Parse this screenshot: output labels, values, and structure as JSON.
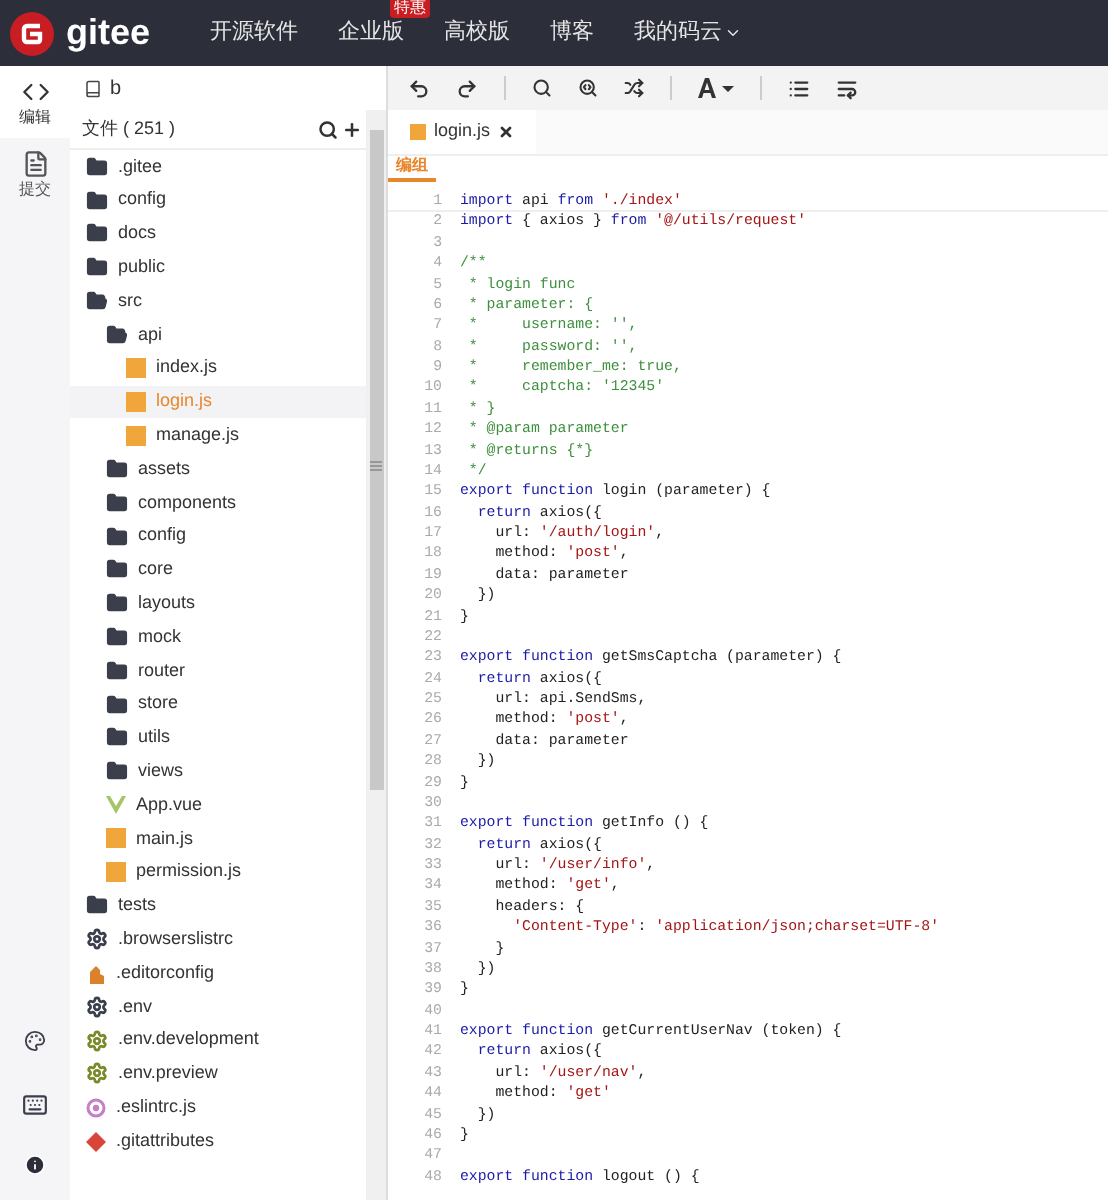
{
  "nav": {
    "logo": "gitee",
    "items": [
      {
        "label": "开源软件"
      },
      {
        "label": "企业版",
        "badge": "特惠"
      },
      {
        "label": "高校版"
      },
      {
        "label": "博客"
      },
      {
        "label": "我的码云",
        "dropdown": true
      }
    ]
  },
  "rail": {
    "items": [
      {
        "label": "编辑",
        "kind": "code",
        "selected": true
      },
      {
        "label": "提交",
        "kind": "commit",
        "selected": false
      }
    ]
  },
  "repo": {
    "name": "b"
  },
  "files": {
    "label": "文件 ( 251 )"
  },
  "tree": [
    {
      "name": ".gitee",
      "kind": "folder",
      "expanded": false,
      "selected": false
    },
    {
      "name": "config",
      "kind": "folder",
      "expanded": false,
      "selected": false
    },
    {
      "name": "docs",
      "kind": "folder",
      "expanded": false,
      "selected": false
    },
    {
      "name": "public",
      "kind": "folder",
      "expanded": false,
      "selected": false
    },
    {
      "name": "src",
      "kind": "folder",
      "expanded": true,
      "selected": false,
      "children": [
        {
          "name": "api",
          "kind": "folder",
          "expanded": true,
          "selected": false,
          "children": [
            {
              "name": "index.js",
              "kind": "js",
              "selected": false
            },
            {
              "name": "login.js",
              "kind": "js",
              "selected": true
            },
            {
              "name": "manage.js",
              "kind": "js",
              "selected": false
            }
          ]
        },
        {
          "name": "assets",
          "kind": "folder",
          "expanded": false,
          "selected": false
        },
        {
          "name": "components",
          "kind": "folder",
          "expanded": false,
          "selected": false
        },
        {
          "name": "config",
          "kind": "folder",
          "expanded": false,
          "selected": false
        },
        {
          "name": "core",
          "kind": "folder",
          "expanded": false,
          "selected": false
        },
        {
          "name": "layouts",
          "kind": "folder",
          "expanded": false,
          "selected": false
        },
        {
          "name": "mock",
          "kind": "folder",
          "expanded": false,
          "selected": false
        },
        {
          "name": "router",
          "kind": "folder",
          "expanded": false,
          "selected": false
        },
        {
          "name": "store",
          "kind": "folder",
          "expanded": false,
          "selected": false
        },
        {
          "name": "utils",
          "kind": "folder",
          "expanded": false,
          "selected": false
        },
        {
          "name": "views",
          "kind": "folder",
          "expanded": false,
          "selected": false
        },
        {
          "name": "App.vue",
          "kind": "vue",
          "selected": false
        },
        {
          "name": "main.js",
          "kind": "js",
          "selected": false
        },
        {
          "name": "permission.js",
          "kind": "js",
          "selected": false
        }
      ]
    },
    {
      "name": "tests",
      "kind": "folder",
      "expanded": false,
      "selected": false
    },
    {
      "name": ".browserslistrc",
      "kind": "gear",
      "color": "#3a3f4b",
      "selected": false
    },
    {
      "name": ".editorconfig",
      "kind": "editorconfig",
      "selected": false
    },
    {
      "name": ".env",
      "kind": "gear",
      "color": "#3a3f4b",
      "selected": false
    },
    {
      "name": ".env.development",
      "kind": "gear",
      "color": "#7a8a2a",
      "selected": false
    },
    {
      "name": ".env.preview",
      "kind": "gear",
      "color": "#7a8a2a",
      "selected": false
    },
    {
      "name": ".eslintrc.js",
      "kind": "eslint",
      "selected": false
    },
    {
      "name": ".gitattributes",
      "kind": "git",
      "selected": false
    }
  ],
  "tabs": [
    {
      "label": "login.js",
      "selected": true,
      "closable": true
    }
  ],
  "mode": {
    "label": "编组"
  },
  "code": [
    {
      "n": "1",
      "segs": [
        {
          "kind": "kw",
          "text": "import"
        },
        {
          "kind": "plain",
          "text": " api "
        },
        {
          "kind": "kw",
          "text": "from"
        },
        {
          "kind": "str",
          "text": " './index'"
        }
      ]
    },
    {
      "n": "2",
      "segs": [
        {
          "kind": "kw",
          "text": "import"
        },
        {
          "kind": "plain",
          "text": " { axios } "
        },
        {
          "kind": "kw",
          "text": "from"
        },
        {
          "kind": "str",
          "text": " '@/utils/request'"
        }
      ]
    },
    {
      "n": "3"
    },
    {
      "n": "4",
      "segs": [
        {
          "kind": "comment",
          "text": "/**"
        }
      ]
    },
    {
      "n": "5",
      "segs": [
        {
          "kind": "comment",
          "text": " * login func"
        }
      ]
    },
    {
      "n": "6",
      "segs": [
        {
          "kind": "comment",
          "text": " * parameter: {"
        }
      ]
    },
    {
      "n": "7",
      "segs": [
        {
          "kind": "comment",
          "text": " *     username: '',"
        }
      ]
    },
    {
      "n": "8",
      "segs": [
        {
          "kind": "comment",
          "text": " *     password: '',"
        }
      ]
    },
    {
      "n": "9",
      "segs": [
        {
          "kind": "comment",
          "text": " *     remember_me: true,"
        }
      ]
    },
    {
      "n": "10",
      "segs": [
        {
          "kind": "comment",
          "text": " *     captcha: '12345'"
        }
      ]
    },
    {
      "n": "11",
      "segs": [
        {
          "kind": "comment",
          "text": " * }"
        }
      ]
    },
    {
      "n": "12",
      "segs": [
        {
          "kind": "comment",
          "text": " * @param parameter"
        }
      ]
    },
    {
      "n": "13",
      "segs": [
        {
          "kind": "comment",
          "text": " * @returns {*}"
        }
      ]
    },
    {
      "n": "14",
      "segs": [
        {
          "kind": "comment",
          "text": " */"
        }
      ]
    },
    {
      "n": "15",
      "segs": [
        {
          "kind": "kw",
          "text": "export function"
        },
        {
          "kind": "plain",
          "text": " login (parameter) {"
        }
      ]
    },
    {
      "n": "16",
      "segs": [
        {
          "kind": "kw",
          "text": "  return"
        },
        {
          "kind": "plain",
          "text": " axios({"
        }
      ]
    },
    {
      "n": "17",
      "segs": [
        {
          "kind": "plain",
          "text": "    url: "
        },
        {
          "kind": "str",
          "text": "'/auth/login'"
        },
        {
          "kind": "plain",
          "text": ","
        }
      ]
    },
    {
      "n": "18",
      "segs": [
        {
          "kind": "plain",
          "text": "    method: "
        },
        {
          "kind": "str",
          "text": "'post'"
        },
        {
          "kind": "plain",
          "text": ","
        }
      ]
    },
    {
      "n": "19",
      "segs": [
        {
          "kind": "plain",
          "text": "    data: parameter"
        }
      ]
    },
    {
      "n": "20",
      "segs": [
        {
          "kind": "plain",
          "text": "  })"
        }
      ]
    },
    {
      "n": "21",
      "segs": [
        {
          "kind": "plain",
          "text": "}"
        }
      ]
    },
    {
      "n": "22"
    },
    {
      "n": "23",
      "segs": [
        {
          "kind": "kw",
          "text": "export function"
        },
        {
          "kind": "plain",
          "text": " getSmsCaptcha (parameter) {"
        }
      ]
    },
    {
      "n": "24",
      "segs": [
        {
          "kind": "kw",
          "text": "  return"
        },
        {
          "kind": "plain",
          "text": " axios({"
        }
      ]
    },
    {
      "n": "25",
      "segs": [
        {
          "kind": "plain",
          "text": "    url: api.SendSms,"
        }
      ]
    },
    {
      "n": "26",
      "segs": [
        {
          "kind": "plain",
          "text": "    method: "
        },
        {
          "kind": "str",
          "text": "'post'"
        },
        {
          "kind": "plain",
          "text": ","
        }
      ]
    },
    {
      "n": "27",
      "segs": [
        {
          "kind": "plain",
          "text": "    data: parameter"
        }
      ]
    },
    {
      "n": "28",
      "segs": [
        {
          "kind": "plain",
          "text": "  })"
        }
      ]
    },
    {
      "n": "29",
      "segs": [
        {
          "kind": "plain",
          "text": "}"
        }
      ]
    },
    {
      "n": "30"
    },
    {
      "n": "31",
      "segs": [
        {
          "kind": "kw",
          "text": "export function"
        },
        {
          "kind": "plain",
          "text": " getInfo () {"
        }
      ]
    },
    {
      "n": "32",
      "segs": [
        {
          "kind": "kw",
          "text": "  return"
        },
        {
          "kind": "plain",
          "text": " axios({"
        }
      ]
    },
    {
      "n": "33",
      "segs": [
        {
          "kind": "plain",
          "text": "    url: "
        },
        {
          "kind": "str",
          "text": "'/user/info'"
        },
        {
          "kind": "plain",
          "text": ","
        }
      ]
    },
    {
      "n": "34",
      "segs": [
        {
          "kind": "plain",
          "text": "    method: "
        },
        {
          "kind": "str",
          "text": "'get'"
        },
        {
          "kind": "plain",
          "text": ","
        }
      ]
    },
    {
      "n": "35",
      "segs": [
        {
          "kind": "plain",
          "text": "    headers: {"
        }
      ]
    },
    {
      "n": "36",
      "segs": [
        {
          "kind": "str",
          "text": "      'Content-Type'"
        },
        {
          "kind": "plain",
          "text": ": "
        },
        {
          "kind": "str",
          "text": "'application/json;charset=UTF-8'"
        }
      ]
    },
    {
      "n": "37",
      "segs": [
        {
          "kind": "plain",
          "text": "    }"
        }
      ]
    },
    {
      "n": "38",
      "segs": [
        {
          "kind": "plain",
          "text": "  })"
        }
      ]
    },
    {
      "n": "39",
      "segs": [
        {
          "kind": "plain",
          "text": "}"
        }
      ]
    },
    {
      "n": "40"
    },
    {
      "n": "41",
      "segs": [
        {
          "kind": "kw",
          "text": "export function"
        },
        {
          "kind": "plain",
          "text": " getCurrentUserNav (token) {"
        }
      ]
    },
    {
      "n": "42",
      "segs": [
        {
          "kind": "kw",
          "text": "  return"
        },
        {
          "kind": "plain",
          "text": " axios({"
        }
      ]
    },
    {
      "n": "43",
      "segs": [
        {
          "kind": "plain",
          "text": "    url: "
        },
        {
          "kind": "str",
          "text": "'/user/nav'"
        },
        {
          "kind": "plain",
          "text": ","
        }
      ]
    },
    {
      "n": "44",
      "segs": [
        {
          "kind": "plain",
          "text": "    method: "
        },
        {
          "kind": "str",
          "text": "'get'"
        }
      ]
    },
    {
      "n": "45",
      "segs": [
        {
          "kind": "plain",
          "text": "  })"
        }
      ]
    },
    {
      "n": "46",
      "segs": [
        {
          "kind": "plain",
          "text": "}"
        }
      ]
    },
    {
      "n": "47"
    },
    {
      "n": "48",
      "segs": [
        {
          "kind": "kw",
          "text": "export function"
        },
        {
          "kind": "plain",
          "text": " logout () {"
        }
      ]
    }
  ]
}
